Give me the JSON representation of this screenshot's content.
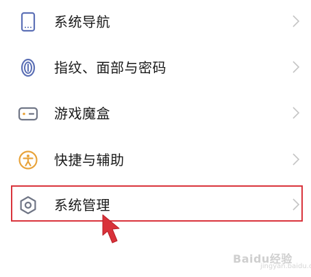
{
  "menu": {
    "items": [
      {
        "label": "系统导航",
        "icon": "phone-navigation-icon"
      },
      {
        "label": "指纹、面部与密码",
        "icon": "fingerprint-icon"
      },
      {
        "label": "游戏魔盒",
        "icon": "game-box-icon"
      },
      {
        "label": "快捷与辅助",
        "icon": "accessibility-icon"
      },
      {
        "label": "系统管理",
        "icon": "system-management-icon"
      }
    ]
  },
  "highlight": {
    "target": "系统管理",
    "color": "#d9323a"
  },
  "watermark": {
    "text": "Baidu经验",
    "sub": "jingyan.baidu.com"
  },
  "colors": {
    "icon_blue": "#5b6fb5",
    "icon_yellow": "#e8a33a",
    "icon_gray": "#6f7585",
    "chevron": "#c4c4c4",
    "text": "#1a1a1a"
  }
}
